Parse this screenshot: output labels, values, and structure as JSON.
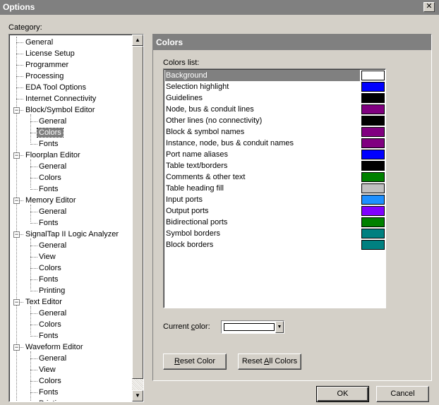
{
  "window": {
    "title": "Options",
    "close_glyph": "✕"
  },
  "category": {
    "label": "Category:",
    "items": [
      {
        "label": "General",
        "level": 0
      },
      {
        "label": "License Setup",
        "level": 0
      },
      {
        "label": "Programmer",
        "level": 0
      },
      {
        "label": "Processing",
        "level": 0
      },
      {
        "label": "EDA Tool Options",
        "level": 0
      },
      {
        "label": "Internet Connectivity",
        "level": 0
      },
      {
        "label": "Block/Symbol Editor",
        "level": 0,
        "expander": "−"
      },
      {
        "label": "General",
        "level": 1
      },
      {
        "label": "Colors",
        "level": 1,
        "selected": true
      },
      {
        "label": "Fonts",
        "level": 1
      },
      {
        "label": "Floorplan Editor",
        "level": 0,
        "expander": "−"
      },
      {
        "label": "General",
        "level": 1
      },
      {
        "label": "Colors",
        "level": 1
      },
      {
        "label": "Fonts",
        "level": 1
      },
      {
        "label": "Memory Editor",
        "level": 0,
        "expander": "−"
      },
      {
        "label": "General",
        "level": 1
      },
      {
        "label": "Fonts",
        "level": 1
      },
      {
        "label": "SignalTap II Logic Analyzer",
        "level": 0,
        "expander": "−"
      },
      {
        "label": "General",
        "level": 1
      },
      {
        "label": "View",
        "level": 1
      },
      {
        "label": "Colors",
        "level": 1
      },
      {
        "label": "Fonts",
        "level": 1
      },
      {
        "label": "Printing",
        "level": 1
      },
      {
        "label": "Text Editor",
        "level": 0,
        "expander": "−"
      },
      {
        "label": "General",
        "level": 1
      },
      {
        "label": "Colors",
        "level": 1
      },
      {
        "label": "Fonts",
        "level": 1
      },
      {
        "label": "Waveform Editor",
        "level": 0,
        "expander": "−"
      },
      {
        "label": "General",
        "level": 1
      },
      {
        "label": "View",
        "level": 1
      },
      {
        "label": "Colors",
        "level": 1
      },
      {
        "label": "Fonts",
        "level": 1
      },
      {
        "label": "Printing",
        "level": 1
      }
    ]
  },
  "scrollbar": {
    "up_glyph": "▲",
    "down_glyph": "▼"
  },
  "panel": {
    "title": "Colors",
    "colors_list_label": "Colors list:",
    "colors": [
      {
        "name": "Background",
        "color": "#ffffff",
        "selected": true
      },
      {
        "name": "Selection highlight",
        "color": "#0000ff"
      },
      {
        "name": "Guidelines",
        "color": "#000000"
      },
      {
        "name": "Node, bus & conduit lines",
        "color": "#800080"
      },
      {
        "name": "Other lines (no connectivity)",
        "color": "#000000"
      },
      {
        "name": "Block & symbol names",
        "color": "#800080"
      },
      {
        "name": "Instance, node, bus & conduit names",
        "color": "#800080"
      },
      {
        "name": "Port name aliases",
        "color": "#0000ff"
      },
      {
        "name": "Table text/borders",
        "color": "#000000"
      },
      {
        "name": "Comments & other text",
        "color": "#008000"
      },
      {
        "name": "Table heading fill",
        "color": "#c0c0c0"
      },
      {
        "name": "Input ports",
        "color": "#1e90ff"
      },
      {
        "name": "Output ports",
        "color": "#8000ff"
      },
      {
        "name": "Bidirectional ports",
        "color": "#008000"
      },
      {
        "name": "Symbol borders",
        "color": "#008080"
      },
      {
        "name": "Block borders",
        "color": "#008080"
      }
    ],
    "current_color": {
      "label_pre": "Current ",
      "label_accel": "c",
      "label_post": "olor:",
      "value": "#ffffff",
      "drop_glyph": "▼"
    },
    "reset_color": {
      "accel": "R",
      "rest": "eset Color"
    },
    "reset_all": {
      "pre": "Reset ",
      "accel": "A",
      "rest": "ll Colors"
    }
  },
  "footer": {
    "ok_label": "OK",
    "cancel_label": "Cancel"
  }
}
